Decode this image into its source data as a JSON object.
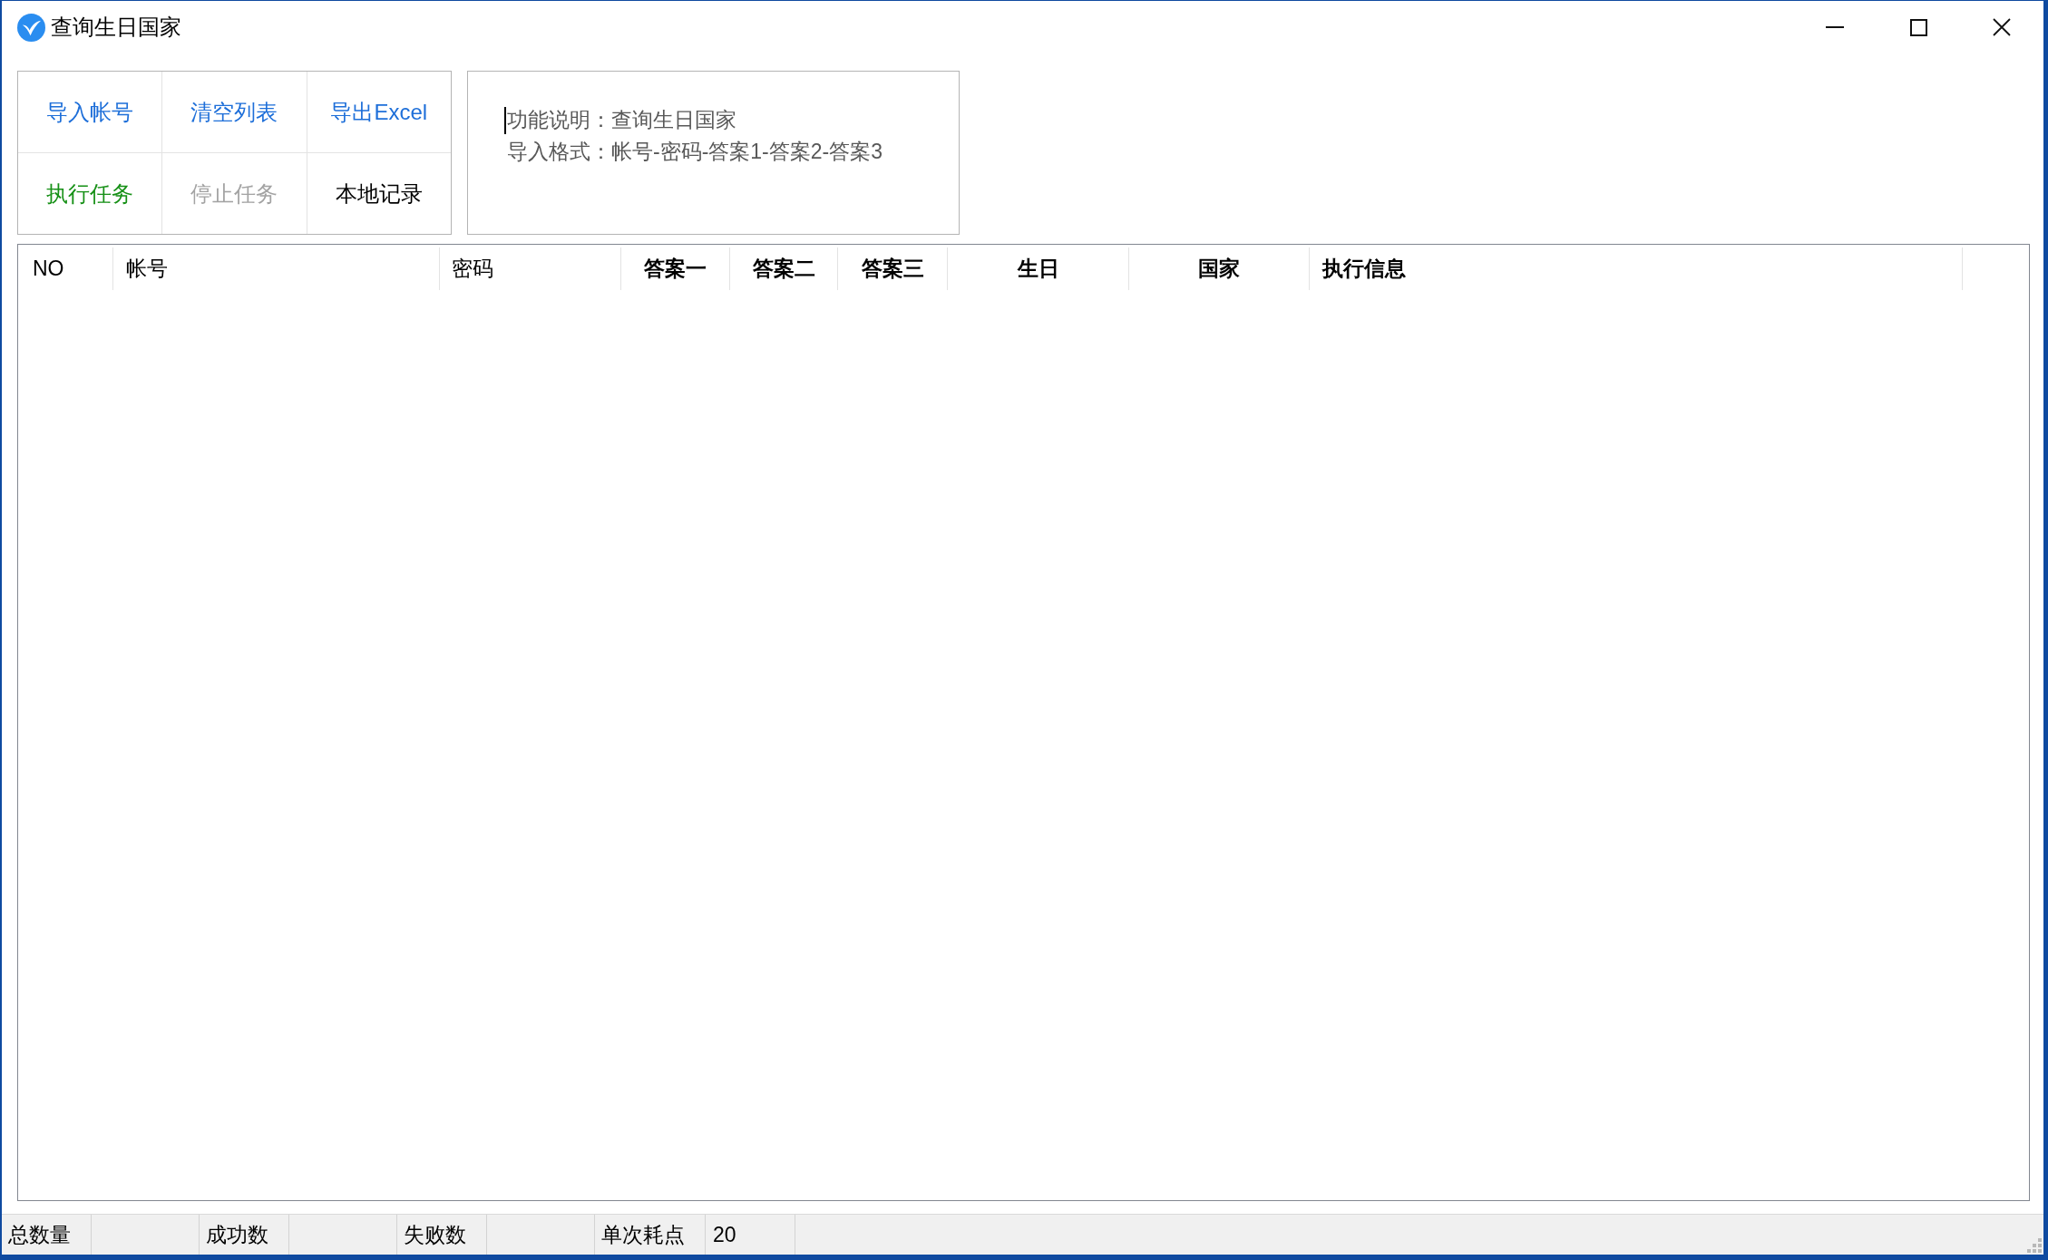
{
  "window": {
    "title": "查询生日国家"
  },
  "toolbar": {
    "buttons": [
      {
        "label": "导入帐号",
        "color": "#1e6fd9",
        "disabled": false
      },
      {
        "label": "清空列表",
        "color": "#1e6fd9",
        "disabled": false
      },
      {
        "label": "导出Excel",
        "color": "#1e6fd9",
        "disabled": false
      },
      {
        "label": "执行任务",
        "color": "#169016",
        "disabled": false
      },
      {
        "label": "停止任务",
        "disabled": true
      },
      {
        "label": "本地记录",
        "color": "#000000",
        "disabled": false
      }
    ]
  },
  "description": {
    "focused": true,
    "lines": [
      "功能说明：查询生日国家",
      "导入格式：帐号-密码-答案1-答案2-答案3"
    ]
  },
  "table": {
    "columns": [
      {
        "label": "NO",
        "bold": false
      },
      {
        "label": "帐号",
        "bold": false
      },
      {
        "label": "密码",
        "bold": false
      },
      {
        "label": "答案一",
        "bold": true
      },
      {
        "label": "答案二",
        "bold": true
      },
      {
        "label": "答案三",
        "bold": true
      },
      {
        "label": "生日",
        "bold": true
      },
      {
        "label": "国家",
        "bold": true
      },
      {
        "label": "执行信息",
        "bold": true
      }
    ]
  },
  "status_bar": {
    "items": [
      {
        "label": "总数量"
      },
      {
        "label": "成功数"
      },
      {
        "label": "失败数"
      },
      {
        "label": "单次耗点",
        "value": "20"
      }
    ]
  }
}
